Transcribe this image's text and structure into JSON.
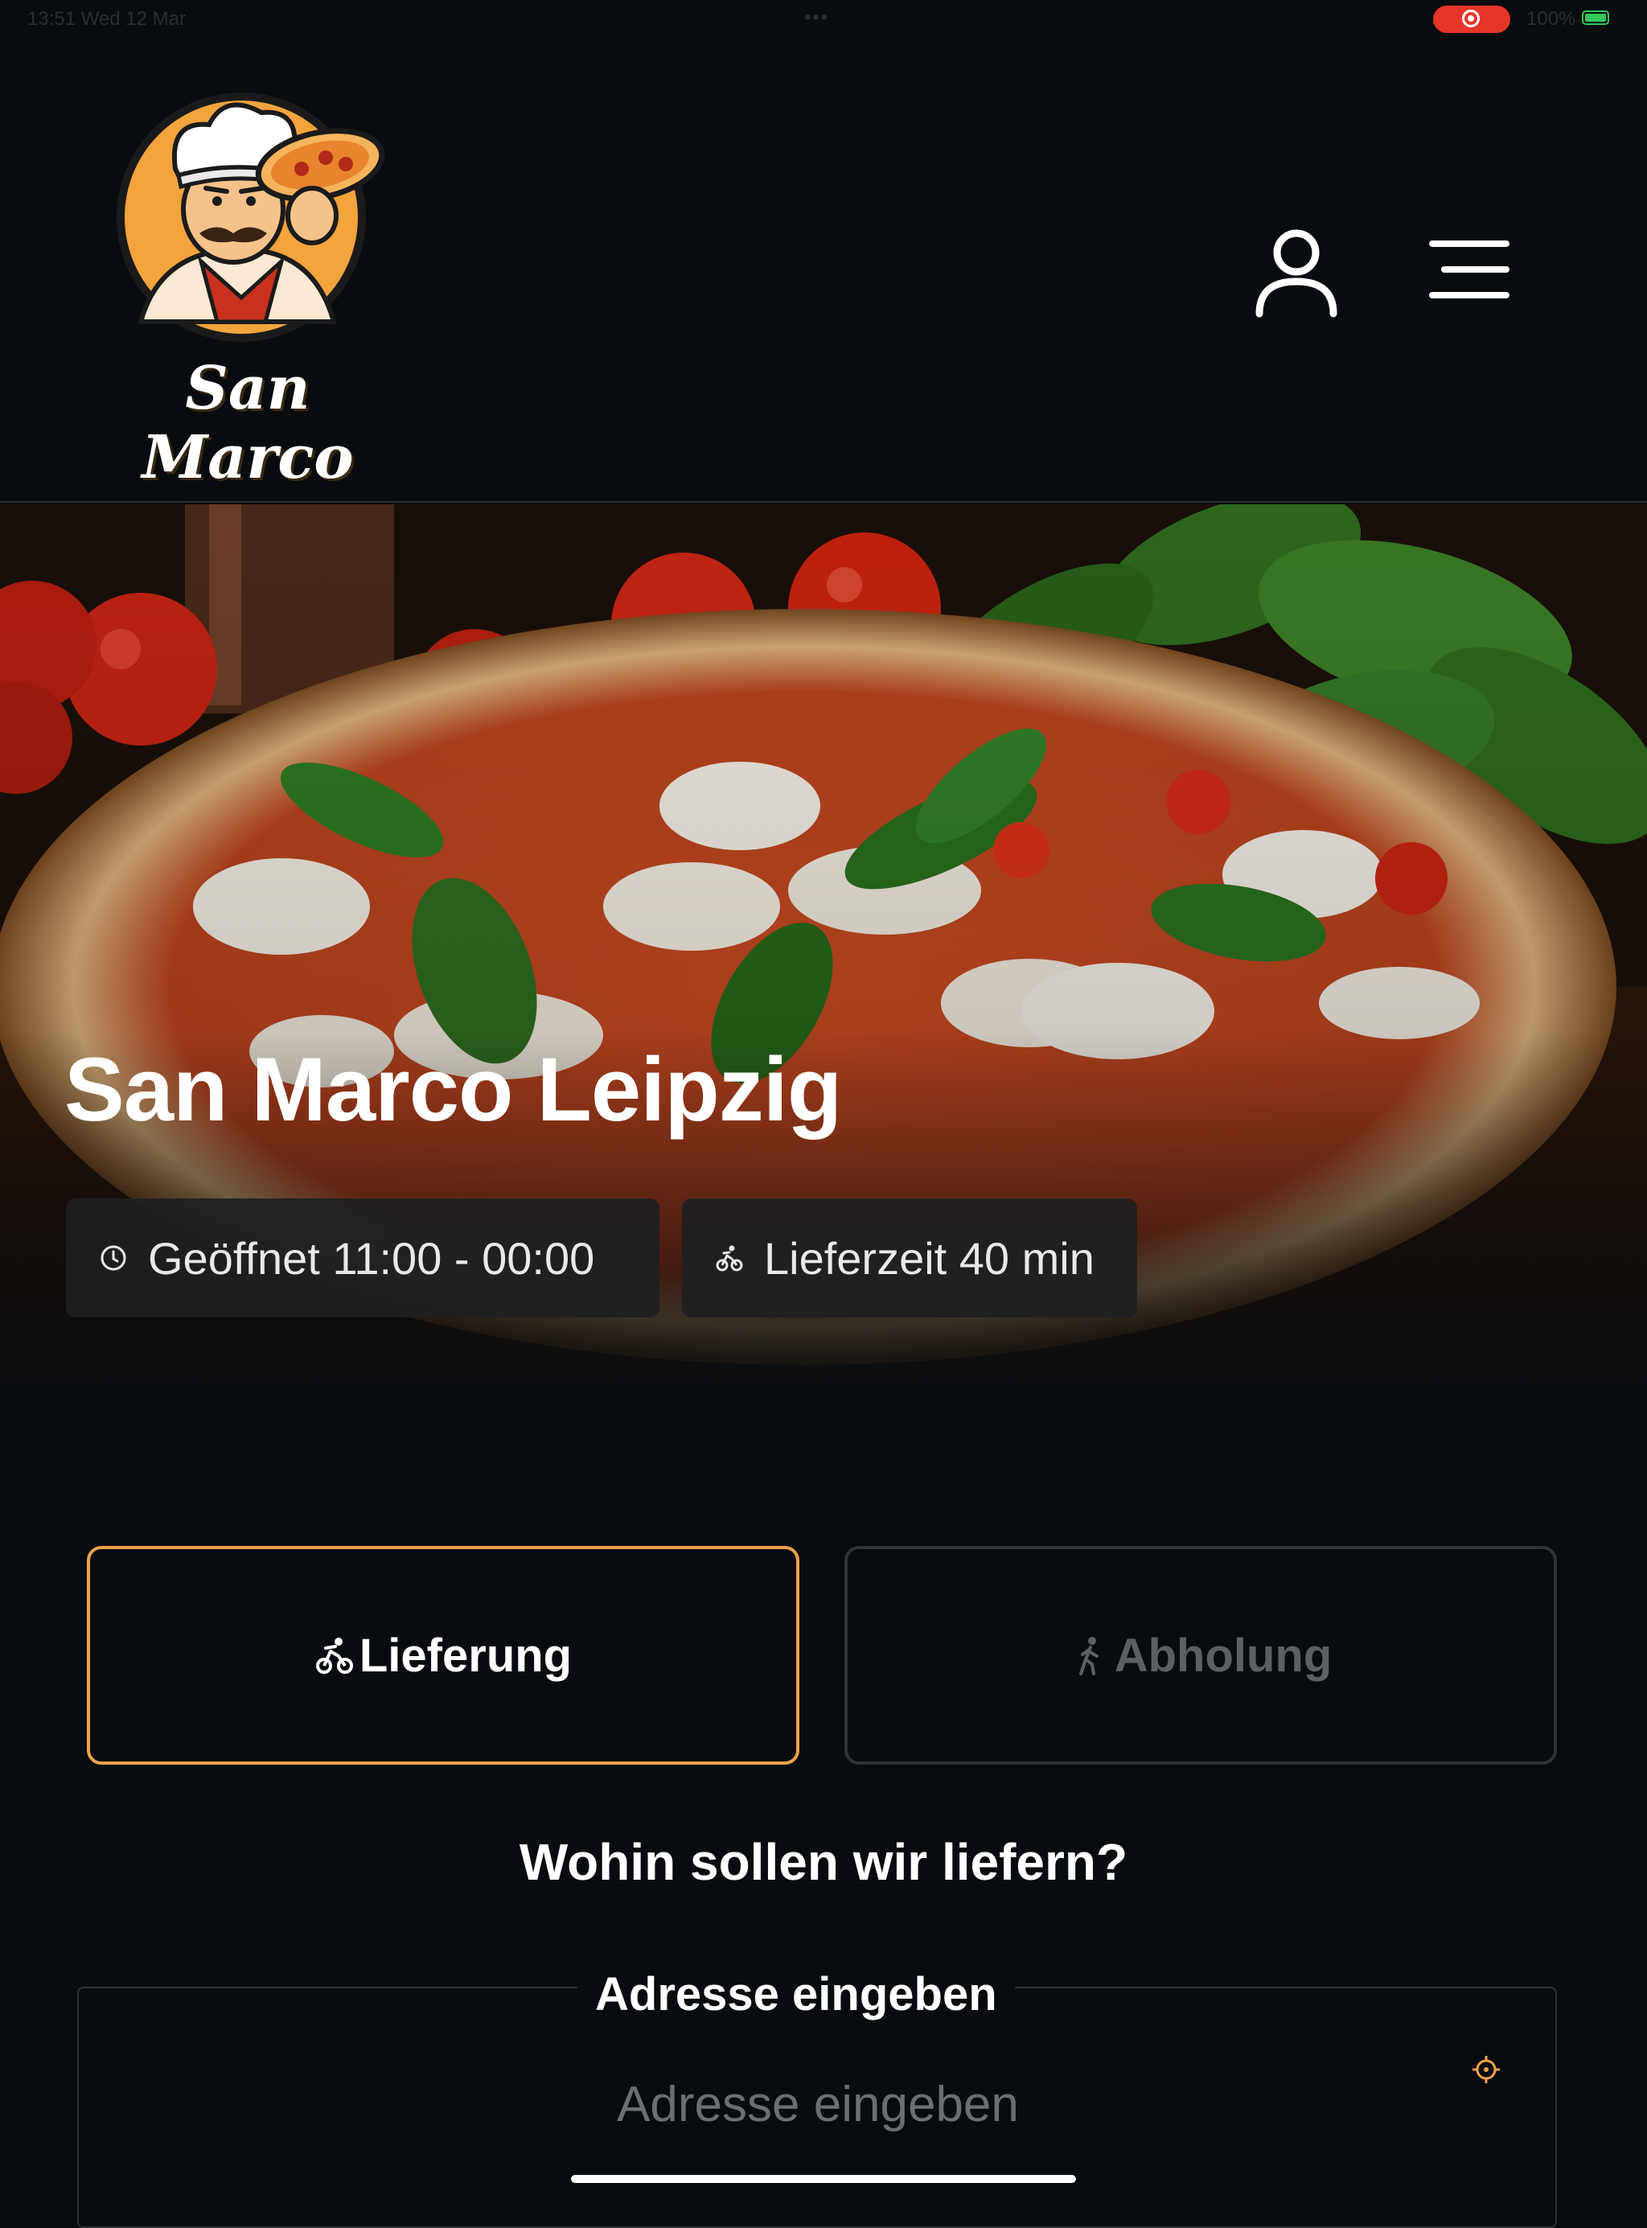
{
  "status_bar": {
    "time": "13:51  Wed 12 Mar",
    "battery": "100%"
  },
  "brand": {
    "name": "San Marco",
    "accent_color": "#f0a04b"
  },
  "header": {
    "user_icon": "user-icon",
    "menu_icon": "hamburger-menu-icon"
  },
  "hero": {
    "title": "San Marco Leipzig",
    "opening_hours": "Geöffnet 11:00 - 00:00",
    "delivery_time": "Lieferzeit 40 min"
  },
  "order_mode": {
    "delivery_label": "Lieferung",
    "pickup_label": "Abholung",
    "selected": "delivery"
  },
  "address": {
    "question": "Wohin sollen wir liefern?",
    "legend": "Adresse eingeben",
    "placeholder": "Adresse eingeben",
    "value": ""
  }
}
